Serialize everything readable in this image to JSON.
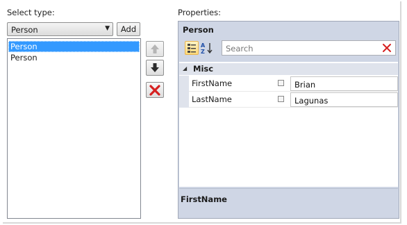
{
  "left": {
    "select_type_label": "Select type:",
    "selected_type": "Person",
    "add_label": "Add",
    "items": [
      {
        "label": "Person",
        "selected": true
      },
      {
        "label": "Person",
        "selected": false
      }
    ]
  },
  "middle": {
    "move_up_icon": "arrow-up-icon",
    "move_down_icon": "arrow-down-icon",
    "delete_icon": "red-x-icon"
  },
  "properties": {
    "label": "Properties:",
    "object_title": "Person",
    "search_placeholder": "Search",
    "category": "Misc",
    "rows": [
      {
        "name": "FirstName",
        "value": "Brian"
      },
      {
        "name": "LastName",
        "value": "Lagunas"
      }
    ],
    "description_title": "FirstName"
  },
  "colors": {
    "selection": "#3399ff",
    "grid_background": "#cfd6e5",
    "delete_red": "#d62020"
  }
}
